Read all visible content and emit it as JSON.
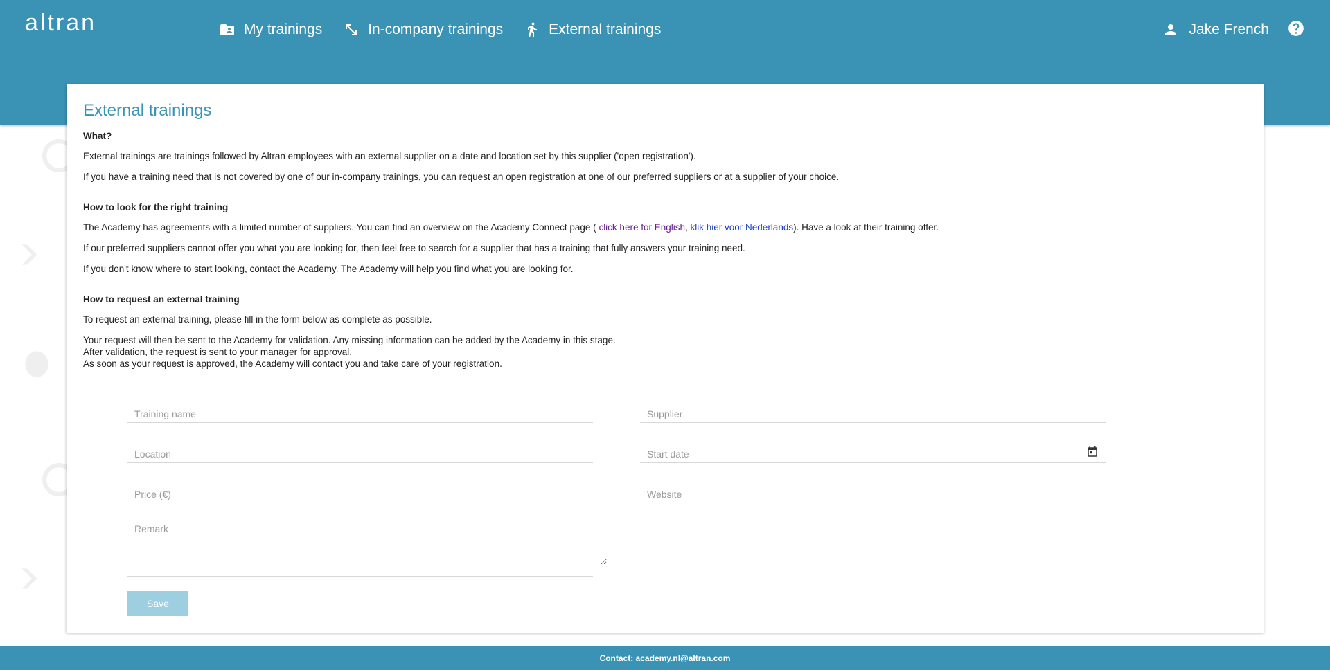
{
  "app": {
    "logo": "altran"
  },
  "nav": {
    "items": [
      {
        "label": "My trainings",
        "icon": "contact-card-icon"
      },
      {
        "label": "In-company trainings",
        "icon": "expand-arrows-icon"
      },
      {
        "label": "External trainings",
        "icon": "walking-person-icon"
      }
    ]
  },
  "user": {
    "name": "Jake French"
  },
  "page": {
    "title": "External trainings",
    "what": {
      "heading": "What?",
      "p1": "External trainings are trainings followed by Altran employees with an external supplier on a date and location set by this supplier ('open registration').",
      "p2": "If you have a training need that is not covered by one of our in-company trainings, you can request an open registration at one of our preferred suppliers or at a supplier of your choice."
    },
    "how_look": {
      "heading": "How to look for the right training",
      "p1_before": "The Academy has agreements with a limited number of suppliers. You can find an overview on the Academy Connect page ( ",
      "link_en": "click here for English",
      "sep": ", ",
      "link_nl": "klik hier voor Nederlands",
      "p1_after": "). Have a look at their training offer.",
      "p2": "If our preferred suppliers cannot offer you what you are looking for, then feel free to search for a supplier that has a training that fully answers your training need.",
      "p3": "If you don't know where to start looking, contact the Academy. The Academy will help you find what you are looking for."
    },
    "how_request": {
      "heading": "How to request an external training",
      "p1": "To request an external training, please fill in the form below as complete as possible.",
      "p2_l1": "Your request will then be sent to the Academy for validation. Any missing information can be added by the Academy in this stage.",
      "p2_l2": "After validation, the request is sent to your manager for approval.",
      "p2_l3": "As soon as your request is approved, the Academy will contact you and take care of your registration."
    }
  },
  "form": {
    "training_name": {
      "placeholder": "Training name",
      "value": ""
    },
    "supplier": {
      "placeholder": "Supplier",
      "value": ""
    },
    "location": {
      "placeholder": "Location",
      "value": ""
    },
    "start_date": {
      "placeholder": "Start date",
      "value": "",
      "icon": "calendar-icon"
    },
    "price": {
      "placeholder": "Price (€)",
      "value": ""
    },
    "website": {
      "placeholder": "Website",
      "value": ""
    },
    "remark": {
      "placeholder": "Remark",
      "value": ""
    },
    "save_label": "Save"
  },
  "footer": {
    "contact": "Contact: academy.nl@altran.com"
  },
  "colors": {
    "brand": "#3a93b4",
    "save_disabled": "#9ecfe1",
    "link_visited": "#6a1f8f",
    "link": "#1a3ec4"
  }
}
